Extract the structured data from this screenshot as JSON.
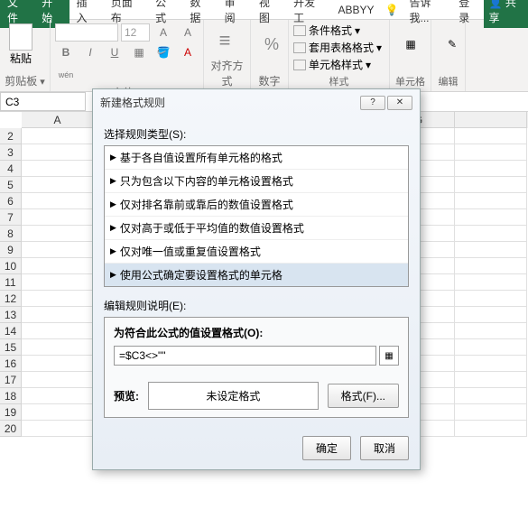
{
  "tabs": {
    "file": "文件",
    "home": "开始",
    "insert": "插入",
    "layout": "页面布",
    "formula": "公式",
    "data": "数据",
    "review": "审阅",
    "view": "视图",
    "dev": "开发工",
    "abbyy": "ABBYY",
    "tell": "告诉我...",
    "login": "登录",
    "share": "共享"
  },
  "ribbon": {
    "paste": "粘贴",
    "clipboard": "剪贴板",
    "fontname": "",
    "fontsize": "12",
    "font": "字体",
    "align": "对齐方式",
    "number": "数字",
    "cond": "条件格式",
    "tablefmt": "套用表格格式",
    "cellstyle": "单元格样式",
    "styles": "样式",
    "cells": "单元格",
    "edit": "编辑"
  },
  "namebox": "C3",
  "cols": [
    "A",
    "",
    "",
    "",
    "",
    "G",
    ""
  ],
  "rows": [
    "2",
    "3",
    "4",
    "5",
    "6",
    "7",
    "8",
    "9",
    "10",
    "11",
    "12",
    "13",
    "14",
    "15",
    "16",
    "17",
    "18",
    "19",
    "20"
  ],
  "dialog": {
    "title": "新建格式规则",
    "help": "?",
    "close": "✕",
    "selectType": "选择规则类型(S):",
    "rules": [
      "基于各自值设置所有单元格的格式",
      "只为包含以下内容的单元格设置格式",
      "仅对排名靠前或靠后的数值设置格式",
      "仅对高于或低于平均值的数值设置格式",
      "仅对唯一值或重复值设置格式",
      "使用公式确定要设置格式的单元格"
    ],
    "editDesc": "编辑规则说明(E):",
    "formulaLabel": "为符合此公式的值设置格式(O):",
    "formula": "=$C3<>\"\"",
    "preview": "预览:",
    "noformat": "未设定格式",
    "formatBtn": "格式(F)...",
    "ok": "确定",
    "cancel": "取消"
  }
}
